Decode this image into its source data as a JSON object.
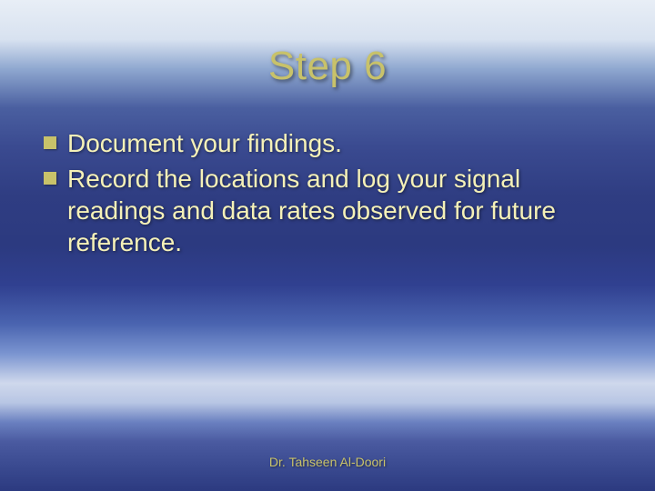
{
  "title": "Step 6",
  "bullets": [
    "Document your findings.",
    "Record the locations and log your signal readings and data rates observed for future reference."
  ],
  "footer": "Dr. Tahseen Al-Doori"
}
